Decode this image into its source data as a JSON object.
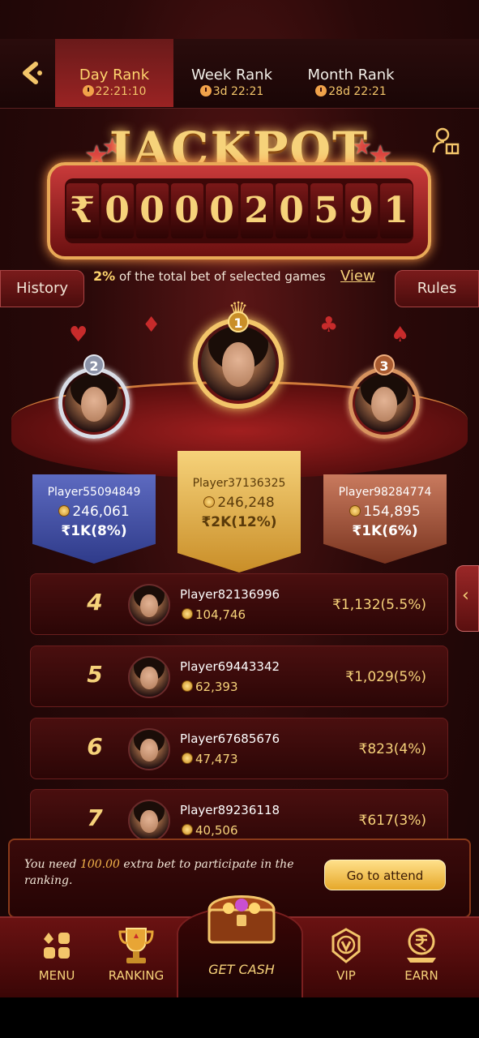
{
  "tabs": [
    {
      "label": "Day Rank",
      "timer": "22:21:10"
    },
    {
      "label": "Week Rank",
      "timer": "3d 22:21"
    },
    {
      "label": "Month Rank",
      "timer": "28d 22:21"
    }
  ],
  "jackpot": {
    "title": "JACKPOT",
    "currency": "₹",
    "digits": [
      "0",
      "0",
      "0",
      "0",
      "2",
      "0",
      "5",
      "9",
      "1"
    ],
    "percent": "2%",
    "note": "of the total bet of selected games",
    "view_label": "View"
  },
  "side_buttons": {
    "history": "History",
    "rules": "Rules"
  },
  "podium": [
    {
      "rank": "2",
      "name": "Player55094849",
      "coins": "246,061",
      "reward": "₹1K(8%)"
    },
    {
      "rank": "1",
      "name": "Player37136325",
      "coins": "246,248",
      "reward": "₹2K(12%)"
    },
    {
      "rank": "3",
      "name": "Player98284774",
      "coins": "154,895",
      "reward": "₹1K(6%)"
    }
  ],
  "rows": [
    {
      "rank": "4",
      "name": "Player82136996",
      "coins": "104,746",
      "reward": "₹1,132(5.5%)"
    },
    {
      "rank": "5",
      "name": "Player69443342",
      "coins": "62,393",
      "reward": "₹1,029(5%)"
    },
    {
      "rank": "6",
      "name": "Player67685676",
      "coins": "47,473",
      "reward": "₹823(4%)"
    },
    {
      "rank": "7",
      "name": "Player89236118",
      "coins": "40,506",
      "reward": "₹617(3%)"
    }
  ],
  "notice": {
    "prefix": "You need",
    "amount": "100.00",
    "suffix": "extra bet to participate in the ranking.",
    "button": "Go to attend"
  },
  "nav": {
    "menu": "MENU",
    "ranking": "RANKING",
    "get_cash": "GET CASH",
    "vip": "VIP",
    "earn": "EARN"
  },
  "colors": {
    "gold": "#f6d27a",
    "dark_red": "#2a0909",
    "accent_red": "#9a2323"
  }
}
